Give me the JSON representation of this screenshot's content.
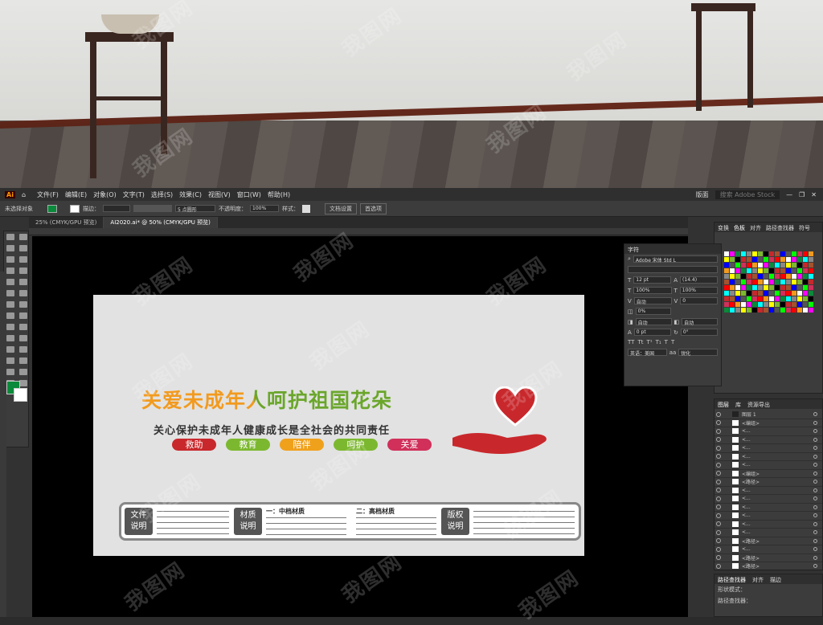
{
  "menu": {
    "items": [
      "文件(F)",
      "编辑(E)",
      "对象(O)",
      "文字(T)",
      "选择(S)",
      "效果(C)",
      "视图(V)",
      "窗口(W)",
      "帮助(H)"
    ],
    "workspace": "版面",
    "search_placeholder": "搜索 Adobe Stock"
  },
  "control": {
    "selection": "未选择对象",
    "stroke_label": "描边：",
    "brush": "5 点圆形",
    "opacity_label": "不透明度：",
    "opacity": "100%",
    "style_label": "样式：",
    "doc_setup": "文档设置",
    "prefs": "首选项"
  },
  "tabs": [
    "25% (CMYK/GPU 预览)",
    "AI2020.ai* @ 50% (CMYK/GPU 预览)"
  ],
  "char_panel": {
    "title": "字符",
    "font": "Adobe 宋体 Std L",
    "size": "12 pt",
    "leading": "(14.4)",
    "hscale": "100%",
    "vscale": "100%",
    "kern": "自动",
    "tracking": "0",
    "shift": "0%",
    "auto1": "自动",
    "auto2": "自动",
    "baseline": "0 pt",
    "rotate": "0°",
    "lang": "英语：美国",
    "aa": "锐化"
  },
  "swatch_panel": {
    "tabs": [
      "变换",
      "色板",
      "对齐",
      "路径查找器",
      "符号"
    ]
  },
  "layers_panel": {
    "tabs": [
      "图层",
      "库",
      "资源导出"
    ],
    "rows": [
      "图层 1",
      "<编组>",
      "<...",
      "<...",
      "<...",
      "<...",
      "<...",
      "<编组>",
      "<路径>",
      "<...",
      "<...",
      "<...",
      "<...",
      "<...",
      "<...",
      "<路径>",
      "<...",
      "<路径>",
      "<路径>"
    ]
  },
  "pathfinder": {
    "tabs": [
      "路径查找器",
      "对齐",
      "描边"
    ],
    "mode_label": "形状模式：",
    "ops_label": "路径查找器："
  },
  "artwork": {
    "headline": "关爱未成年人呵护祖国花朵",
    "subtitle": "关心保护未成年人健康成长是全社会的共同责任",
    "pills": [
      "救助",
      "教育",
      "陪伴",
      "呵护",
      "关爱"
    ],
    "tags": [
      "文件\n说明",
      "材质\n说明",
      "版权\n说明"
    ],
    "sec1": "一：中档材质",
    "sec2": "二：高档材质",
    "colors": {
      "headline_orange": "#f29a1e",
      "headline_green": "#6aa62a",
      "red": "#c8282c",
      "pill_green": "#7cb82f",
      "pill_orange": "#f0a11c",
      "pill_pink": "#d0305a"
    }
  },
  "watermark": "我图网"
}
